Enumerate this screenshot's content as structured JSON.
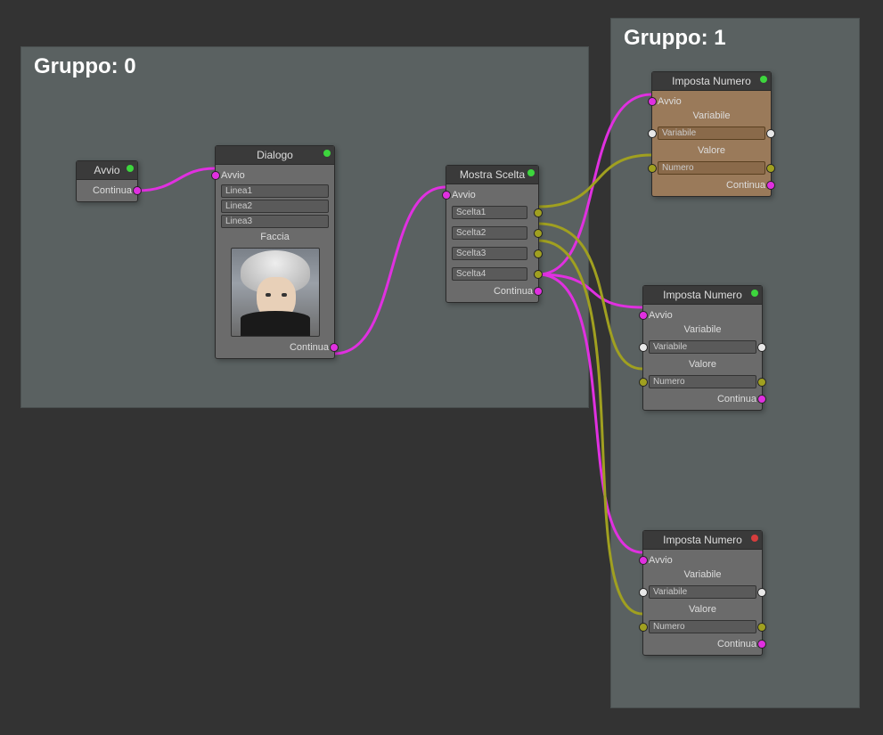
{
  "groups": [
    {
      "id": 0,
      "label": "Gruppo: 0"
    },
    {
      "id": 1,
      "label": "Gruppo: 1"
    }
  ],
  "nodes": {
    "avvio": {
      "title": "Avvio",
      "continua": "Continua",
      "status": "green"
    },
    "dialogo": {
      "title": "Dialogo",
      "avvio": "Avvio",
      "lines": [
        "Linea1",
        "Linea2",
        "Linea3"
      ],
      "faccia": "Faccia",
      "continua": "Continua",
      "status": "green"
    },
    "mostra": {
      "title": "Mostra Scelta",
      "avvio": "Avvio",
      "choices": [
        "Scelta1",
        "Scelta2",
        "Scelta3",
        "Scelta4"
      ],
      "continua": "Continua",
      "status": "green"
    },
    "imposta1": {
      "title": "Imposta Numero",
      "avvio": "Avvio",
      "variabile_label": "Variabile",
      "variabile": "Variabile",
      "valore_label": "Valore",
      "numero": "Numero",
      "continua": "Continua",
      "status": "green"
    },
    "imposta2": {
      "title": "Imposta Numero",
      "avvio": "Avvio",
      "variabile_label": "Variabile",
      "variabile": "Variabile",
      "valore_label": "Valore",
      "numero": "Numero",
      "continua": "Continua",
      "status": "green"
    },
    "imposta3": {
      "title": "Imposta Numero",
      "avvio": "Avvio",
      "variabile_label": "Variabile",
      "variabile": "Variabile",
      "valore_label": "Valore",
      "numero": "Numero",
      "continua": "Continua",
      "status": "red"
    }
  },
  "colors": {
    "pink": "#e030e0",
    "olive": "#a0a020"
  }
}
